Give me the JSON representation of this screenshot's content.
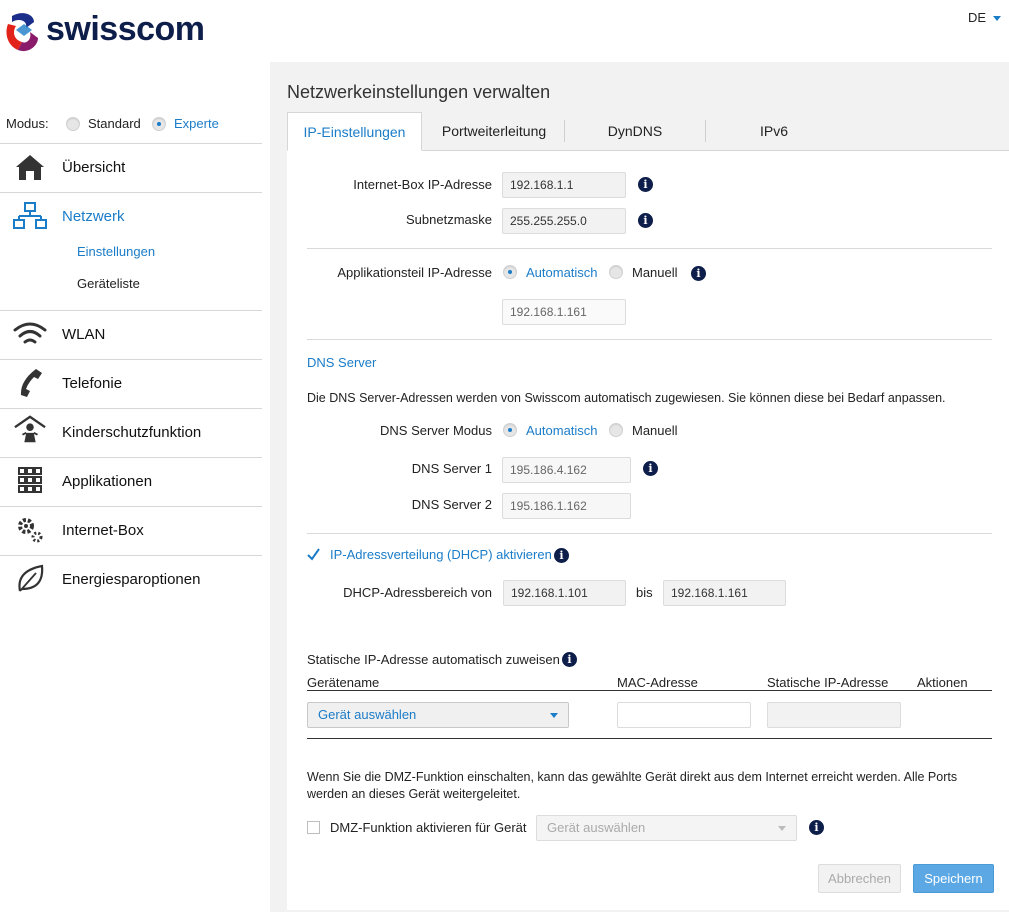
{
  "header": {
    "brand": "swisscom",
    "language": "DE"
  },
  "sidebar": {
    "mode_label": "Modus:",
    "mode_options": [
      {
        "label": "Standard",
        "selected": false
      },
      {
        "label": "Experte",
        "selected": true
      }
    ],
    "items": [
      {
        "label": "Übersicht",
        "icon": "home-icon"
      },
      {
        "label": "Netzwerk",
        "icon": "network-icon",
        "active": true,
        "sub": [
          {
            "label": "Einstellungen",
            "active": true
          },
          {
            "label": "Geräteliste"
          }
        ]
      },
      {
        "label": "WLAN",
        "icon": "wifi-icon"
      },
      {
        "label": "Telefonie",
        "icon": "phone-icon"
      },
      {
        "label": "Kinderschutzfunktion",
        "icon": "child-protection-icon"
      },
      {
        "label": "Applikationen",
        "icon": "apps-grid-icon"
      },
      {
        "label": "Internet-Box",
        "icon": "gears-icon"
      },
      {
        "label": "Energiesparoptionen",
        "icon": "leaf-icon"
      }
    ]
  },
  "page_title": "Netzwerkeinstellungen verwalten",
  "tabs": [
    "IP-Einstellungen",
    "Portweiterleitung",
    "DynDNS",
    "IPv6"
  ],
  "form": {
    "box_ip_label": "Internet-Box IP-Adresse",
    "box_ip_value": "192.168.1.1",
    "subnet_label": "Subnetzmaske",
    "subnet_value": "255.255.255.0",
    "app_ip_label": "Applikationsteil IP-Adresse",
    "app_ip_opt_auto": "Automatisch",
    "app_ip_opt_manual": "Manuell",
    "app_ip_value": "192.168.1.161",
    "dns_heading": "DNS Server",
    "dns_info": "Die DNS Server-Adressen werden von Swisscom automatisch zugewiesen. Sie können diese bei Bedarf anpassen.",
    "dns_mode_label": "DNS Server Modus",
    "dns_mode_auto": "Automatisch",
    "dns_mode_manual": "Manuell",
    "dns1_label": "DNS Server 1",
    "dns1_value": "195.186.4.162",
    "dns2_label": "DNS Server 2",
    "dns2_value": "195.186.1.162",
    "dhcp_checkbox_label": "IP-Adressverteilung (DHCP) aktivieren",
    "dhcp_checked": true,
    "dhcp_range_label": "DHCP-Adressbereich von",
    "dhcp_from": "192.168.1.101",
    "dhcp_to_label": "bis",
    "dhcp_to": "192.168.1.161",
    "static_title": "Statische IP-Adresse automatisch zuweisen",
    "static_columns": [
      "Gerätename",
      "MAC-Adresse",
      "Statische IP-Adresse",
      "Aktionen"
    ],
    "device_select": "Gerät auswählen",
    "dmz_info": "Wenn Sie die DMZ-Funktion einschalten, kann das gewählte Gerät direkt aus dem Internet erreicht werden. Alle Ports werden an dieses Gerät weitergeleitet.",
    "dmz_checkbox_label": "DMZ-Funktion aktivieren für Gerät",
    "dmz_select": "Gerät auswählen",
    "cancel_label": "Abbrechen",
    "save_label": "Speichern"
  },
  "colors": {
    "accent": "#1b7cc8",
    "navy": "#0e1e4a",
    "brand_red": "#e2231a"
  }
}
